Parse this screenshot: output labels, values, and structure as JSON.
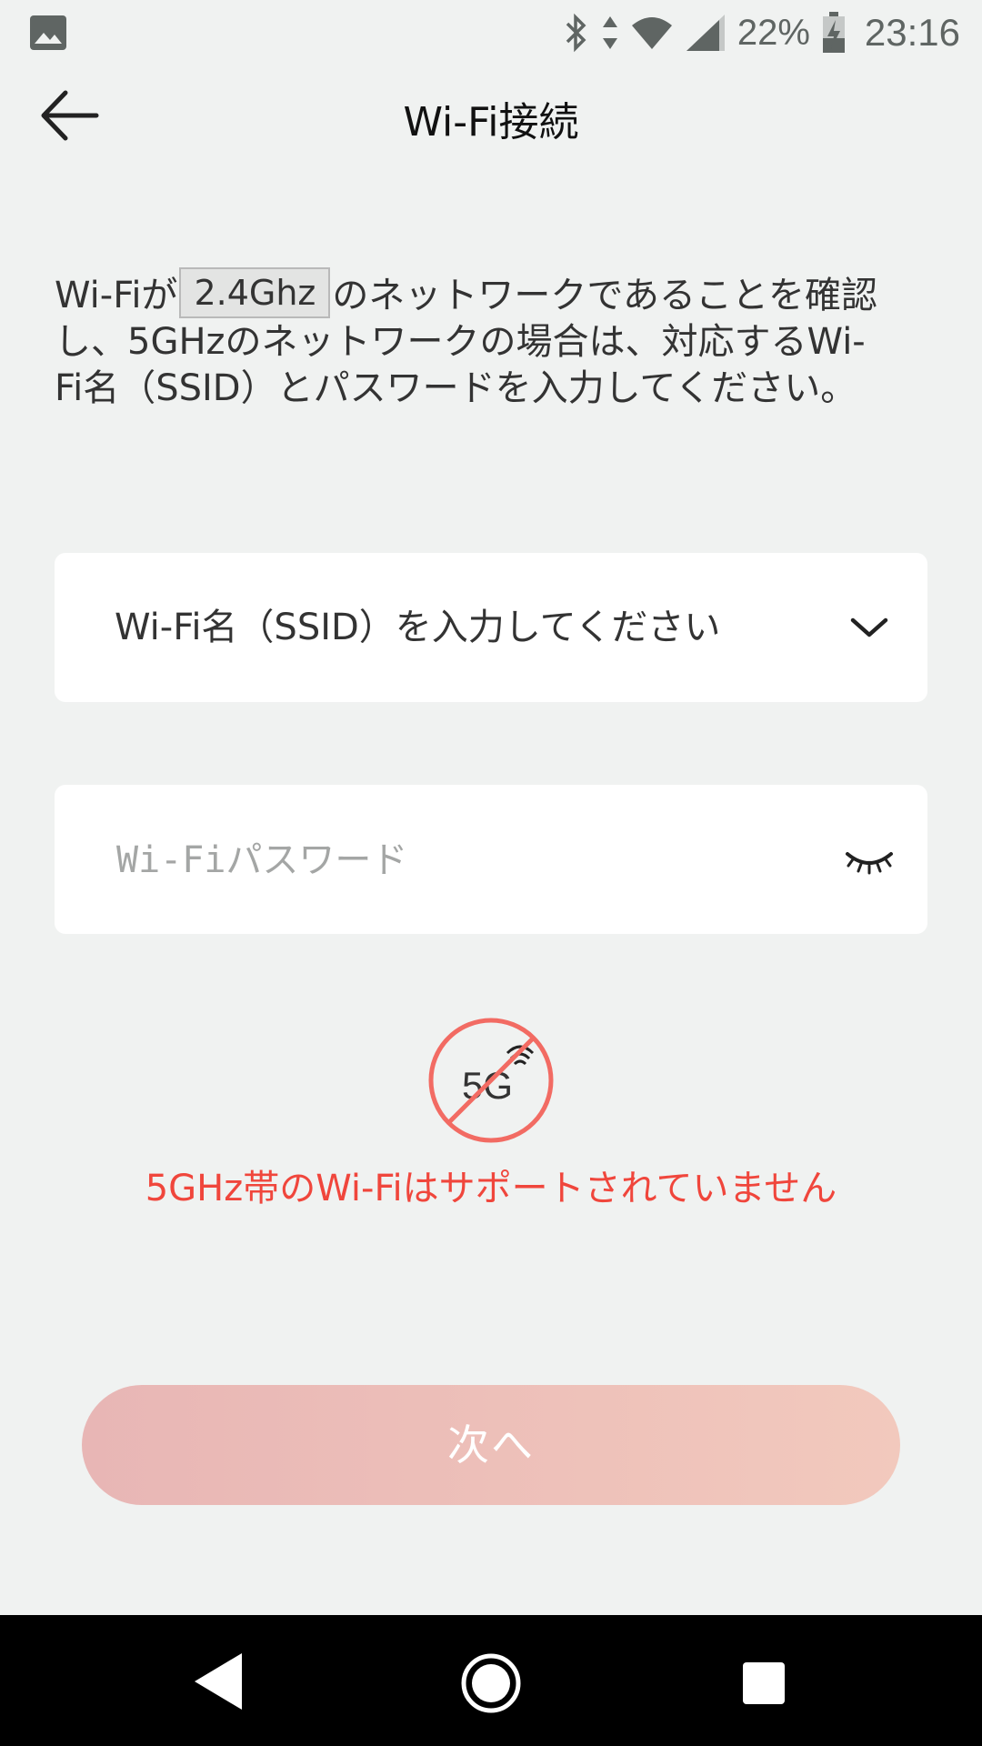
{
  "status_bar": {
    "battery_percent": "22%",
    "time": "23:16",
    "icons": [
      "gallery-icon",
      "bluetooth-icon",
      "data-arrows-icon",
      "wifi-icon",
      "signal-icon",
      "battery-charging-icon"
    ]
  },
  "header": {
    "title": "Wi-Fi接続",
    "back_icon": "arrow-left-icon"
  },
  "instruction": {
    "prefix": "Wi-Fiが",
    "highlight": "2.4Ghz",
    "suffix": "のネットワークであることを確認し、5GHzのネットワークの場合は、対応するWi-Fi名（SSID）とパスワードを入力してください。"
  },
  "ssid_field": {
    "text": "Wi-Fi名（SSID）を入力してください",
    "icon": "chevron-down-icon"
  },
  "password_field": {
    "placeholder": "Wi-Fiパスワード",
    "value": "",
    "icon": "eye-closed-icon"
  },
  "warning": {
    "icon_label": "5G",
    "text": "5GHz帯のWi-Fiはサポートされていません",
    "color": "#f0463c"
  },
  "next_button": {
    "label": "次へ"
  },
  "nav_bar": {
    "icons": [
      "nav-back-icon",
      "nav-home-icon",
      "nav-recent-icon"
    ]
  },
  "colors": {
    "background": "#f0f2f1",
    "accent_red": "#f0463c",
    "button_gradient_start": "#e8b6b5",
    "button_gradient_end": "#f2c9bd"
  }
}
